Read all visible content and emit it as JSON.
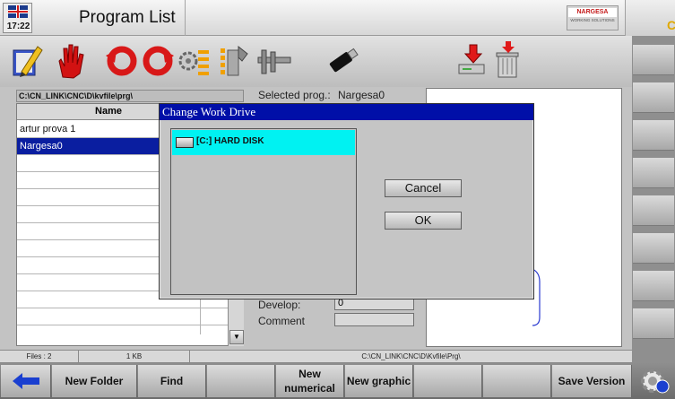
{
  "header": {
    "clock": "17:22",
    "title": "Program List",
    "logo_brand": "NARGESA",
    "logo_tagline": "WORKING SOLUTIONS",
    "edge_glyph": "C"
  },
  "toolbar": {
    "icons": [
      "edit-pencil-icon",
      "stop-hand-icon",
      "rotate-left-icon",
      "rotate-right-icon",
      "gear-list-icon",
      "tool-settings-icon",
      "caliper-icon",
      "usb-stick-icon",
      "import-drive-icon",
      "trash-can-icon"
    ]
  },
  "file_panel": {
    "path": "C:\\CN_LINK\\CNC\\D\\kvfile\\prg\\",
    "column_name": "Name",
    "files": [
      "artur prova 1",
      "Nargesa0"
    ],
    "selected_index": 1
  },
  "info": {
    "selected_label": "Selected prog.:",
    "selected_value": "Nargesa0",
    "develop_label": "Develop:",
    "develop_value": "0",
    "comment_label": "Comment"
  },
  "dialog": {
    "title": "Change Work Drive",
    "drives": [
      "[C:] HARD DISK"
    ],
    "cancel": "Cancel",
    "ok": "OK"
  },
  "status": {
    "files": "Files : 2",
    "size": "1 KB",
    "path": "C:\\CN_LINK\\CNC\\D\\Kvfile\\Prg\\"
  },
  "bottom": {
    "new_folder": "New Folder",
    "find": "Find",
    "new_numerical": "New\nnumerical",
    "new_graphic": "New graphic",
    "save_version": "Save Version"
  },
  "colors": {
    "selection": "#0a1ea0",
    "dialog_title": "#000fa8",
    "drive_highlight": "#00f2f2",
    "back_arrow": "#1a3fd0"
  }
}
